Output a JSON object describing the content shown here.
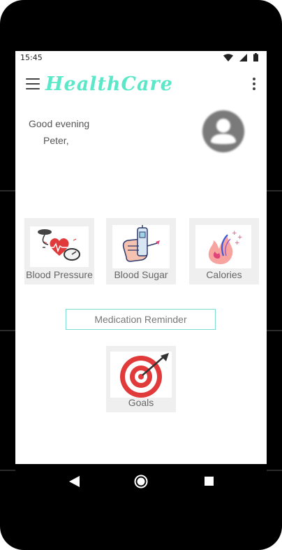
{
  "status_bar": {
    "time": "15:45"
  },
  "app_bar": {
    "title": "HealthCare"
  },
  "greeting": {
    "salutation": "Good evening",
    "name": "Peter,"
  },
  "tiles": [
    {
      "label": "Blood Pressure",
      "icon": "blood-pressure-monitor-icon"
    },
    {
      "label": "Blood Sugar",
      "icon": "glucose-meter-icon"
    },
    {
      "label": "Calories",
      "icon": "flame-icon"
    }
  ],
  "medication_button": {
    "label": "Medication Reminder"
  },
  "goals_tile": {
    "label": "Goals",
    "icon": "target-icon"
  },
  "colors": {
    "accent": "#5be8c9",
    "tile_bg": "#efefef",
    "button_border": "#7fdcd2"
  }
}
